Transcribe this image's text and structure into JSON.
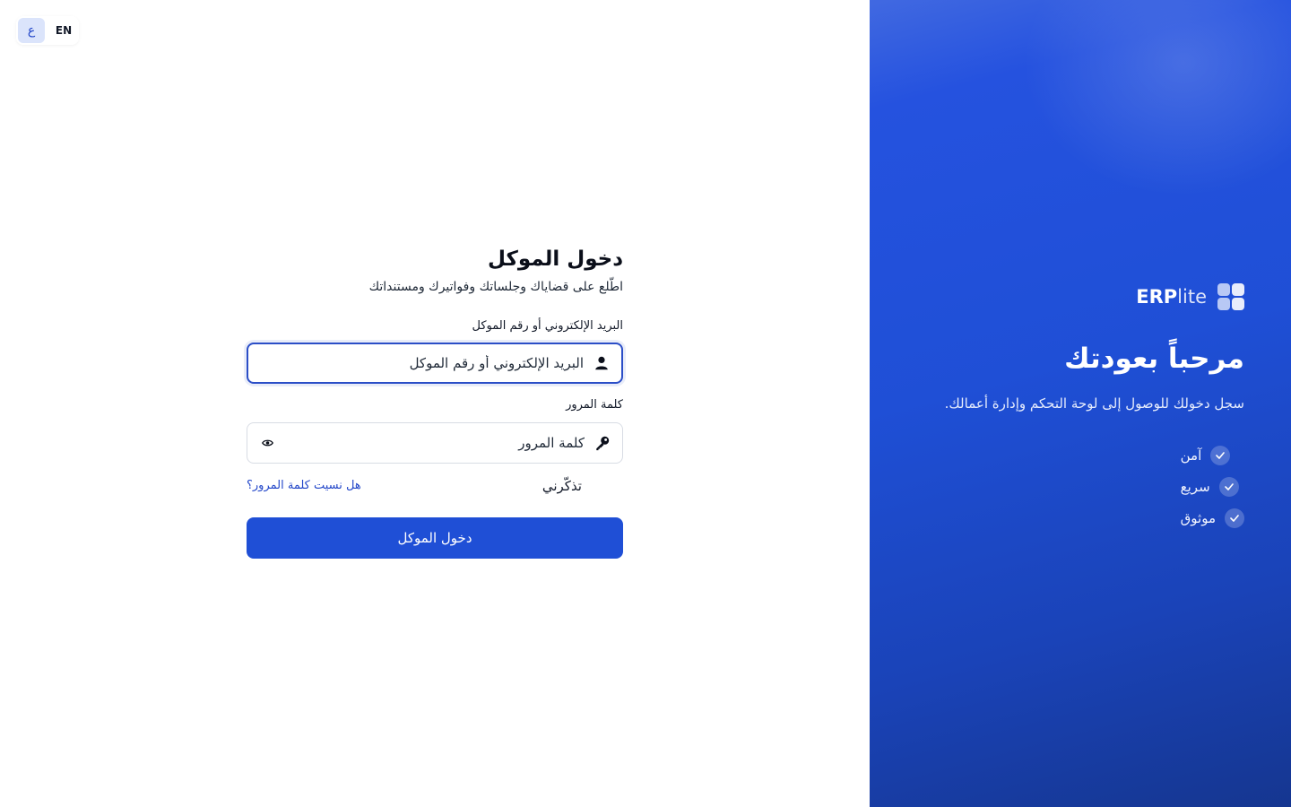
{
  "lang_switch": {
    "arabic_label": "ع",
    "english_label": "EN",
    "active": "ar"
  },
  "login": {
    "title": "دخول الموكل",
    "subtitle": "اطّلع على قضاياك وجلساتك وفواتيرك ومستنداتك",
    "email_label": "البريد الإلكتروني أو رقم الموكل",
    "email_placeholder": "البريد الإلكتروني أو رقم الموكل",
    "email_value": "",
    "password_label": "كلمة المرور",
    "password_placeholder": "كلمة المرور",
    "password_value": "",
    "remember_label": "تذكّرني",
    "forgot_label": "هل نسيت كلمة المرور؟",
    "submit_label": "دخول الموكل"
  },
  "hero": {
    "brand_bold": "ERP",
    "brand_light": "lite",
    "title": "مرحباً بعودتك",
    "subtitle": "سجل دخولك للوصول إلى لوحة التحكم وإدارة أعمالك.",
    "features": [
      {
        "label": "آمن"
      },
      {
        "label": "سريع"
      },
      {
        "label": "موثوق"
      }
    ]
  },
  "icons": {
    "email_field": "user-icon",
    "password_field": "key-icon",
    "password_toggle": "eye-icon",
    "feature": "check-icon",
    "brand": "grid-logo-icon"
  },
  "colors": {
    "primary": "#1f4fd6",
    "link": "#2347c9",
    "hero_gradient_start": "#4169e1",
    "hero_gradient_end": "#153690"
  }
}
